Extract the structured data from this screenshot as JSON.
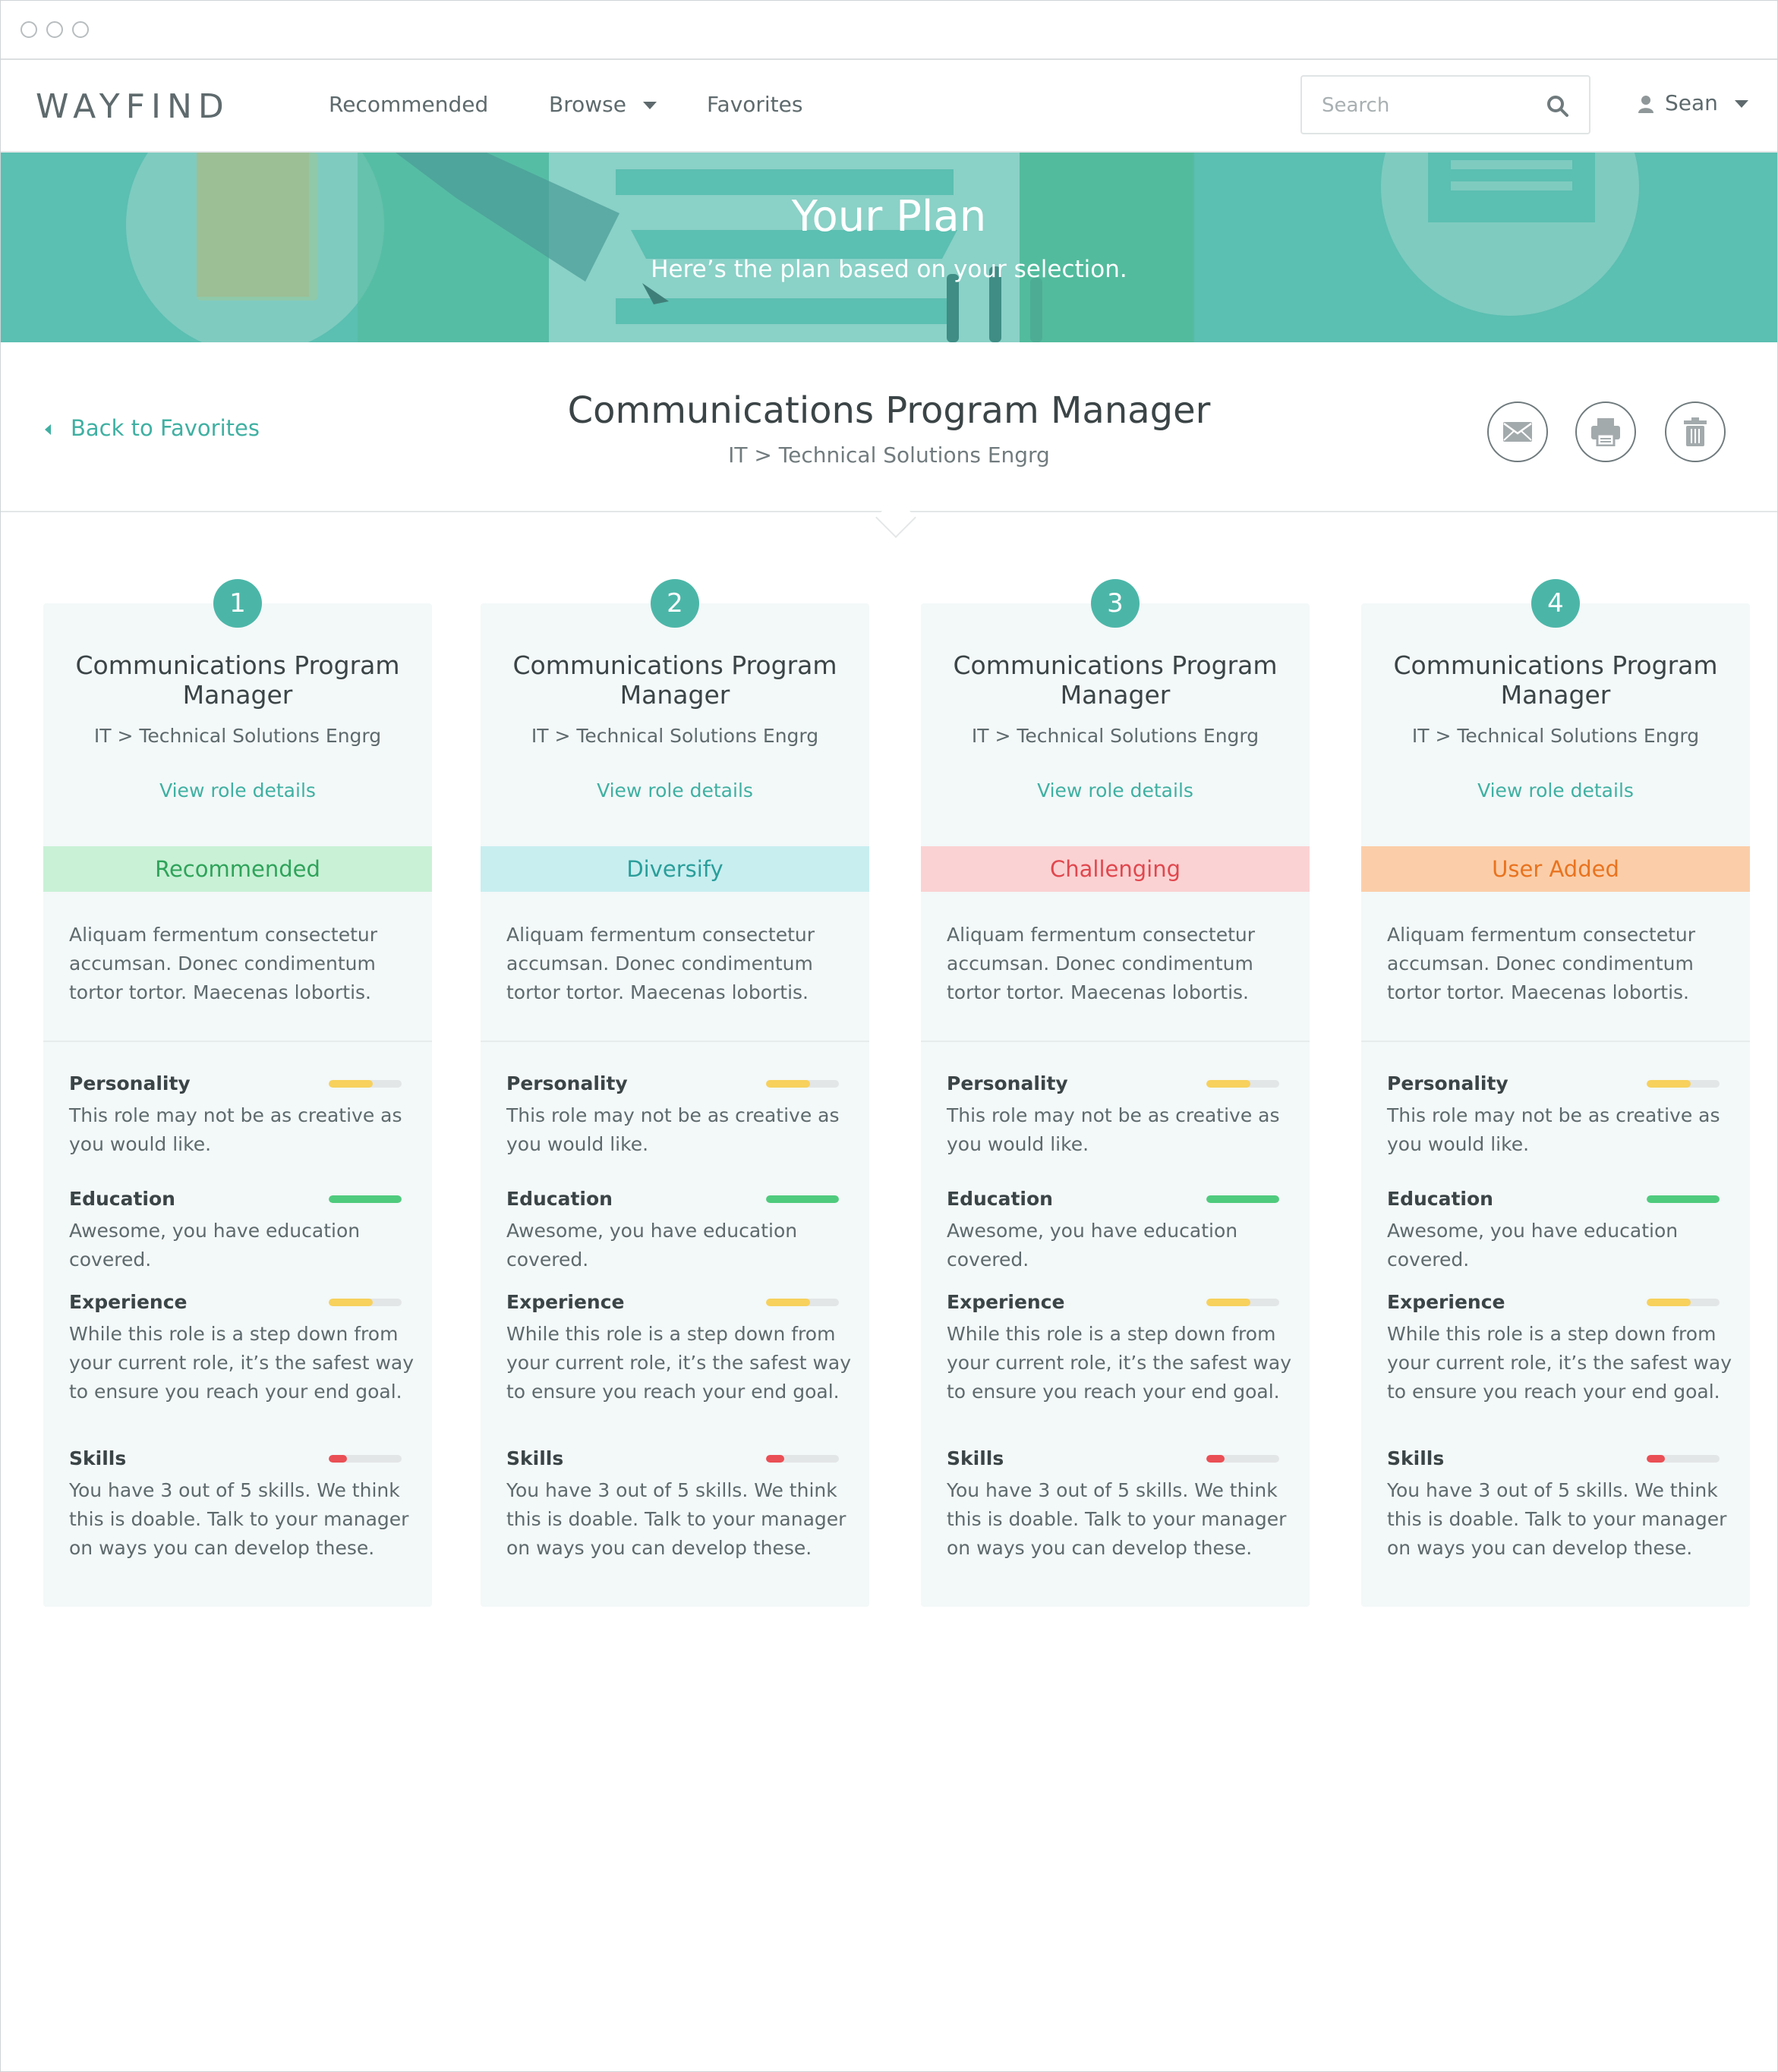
{
  "window": {
    "controls": [
      "close",
      "minimize",
      "maximize"
    ]
  },
  "nav": {
    "logo": "WAYFIND",
    "items": [
      {
        "label": "Recommended"
      },
      {
        "label": "Browse",
        "has_dropdown": true
      },
      {
        "label": "Favorites"
      }
    ],
    "search": {
      "placeholder": "Search",
      "value": ""
    },
    "user": {
      "name": "Sean"
    }
  },
  "hero": {
    "title": "Your Plan",
    "subtitle": "Here’s the plan based on your selection."
  },
  "role": {
    "back_label": "Back to Favorites",
    "title": "Communications Program Manager",
    "path": "IT > Technical Solutions Engrg",
    "actions": [
      "mail-icon",
      "print-icon",
      "trash-icon"
    ]
  },
  "colors": {
    "accent": "#4bb6a8",
    "hero_bg": "#5bbfb1",
    "bar_yellow": "#f7d15c",
    "bar_green": "#4fcb7e",
    "bar_red": "#ea4f55"
  },
  "cards": [
    {
      "number": "1",
      "title": "Communications Program Manager",
      "path": "IT > Technical Solutions Engrg",
      "link": "View role details",
      "tag": "Recommended",
      "description": "Aliquam fermentum consectetur accumsan. Donec condimentum tortor tortor. Maecenas lobortis.",
      "metrics": [
        {
          "label": "Personality",
          "text": "This role may not be as creative as you would like.",
          "level": 0.6,
          "color": "#f7d15c"
        },
        {
          "label": "Education",
          "text": "Awesome, you have education covered.",
          "level": 1.0,
          "color": "#4fcb7e"
        },
        {
          "label": "Experience",
          "text": "While this role is a step down from your current role, it’s the safest way to ensure you reach your end goal.",
          "level": 0.6,
          "color": "#f7d15c"
        },
        {
          "label": "Skills",
          "text": "You have 3 out of 5 skills. We think this is doable. Talk to your manager on ways you can develop these.",
          "level": 0.25,
          "color": "#ea4f55"
        }
      ]
    },
    {
      "number": "2",
      "title": "Communications Program Manager",
      "path": "IT > Technical Solutions Engrg",
      "link": "View role details",
      "tag": "Diversify",
      "description": "Aliquam fermentum consectetur accumsan. Donec condimentum tortor tortor. Maecenas lobortis.",
      "metrics": [
        {
          "label": "Personality",
          "text": "This role may not be as creative as you would like.",
          "level": 0.6,
          "color": "#f7d15c"
        },
        {
          "label": "Education",
          "text": "Awesome, you have education covered.",
          "level": 1.0,
          "color": "#4fcb7e"
        },
        {
          "label": "Experience",
          "text": "While this role is a step down from your current role, it’s the safest way to ensure you reach your end goal.",
          "level": 0.6,
          "color": "#f7d15c"
        },
        {
          "label": "Skills",
          "text": "You have 3 out of 5 skills. We think this is doable. Talk to your manager on ways you can develop these.",
          "level": 0.25,
          "color": "#ea4f55"
        }
      ]
    },
    {
      "number": "3",
      "title": "Communications Program Manager",
      "path": "IT > Technical Solutions Engrg",
      "link": "View role details",
      "tag": "Challenging",
      "description": "Aliquam fermentum consectetur accumsan. Donec condimentum tortor tortor. Maecenas lobortis.",
      "metrics": [
        {
          "label": "Personality",
          "text": "This role may not be as creative as you would like.",
          "level": 0.6,
          "color": "#f7d15c"
        },
        {
          "label": "Education",
          "text": "Awesome, you have education covered.",
          "level": 1.0,
          "color": "#4fcb7e"
        },
        {
          "label": "Experience",
          "text": "While this role is a step down from your current role, it’s the safest way to ensure you reach your end goal.",
          "level": 0.6,
          "color": "#f7d15c"
        },
        {
          "label": "Skills",
          "text": "You have 3 out of 5 skills. We think this is doable. Talk to your manager on ways you can develop these.",
          "level": 0.25,
          "color": "#ea4f55"
        }
      ]
    },
    {
      "number": "4",
      "title": "Communications Program Manager",
      "path": "IT > Technical Solutions Engrg",
      "link": "View role details",
      "tag": "User Added",
      "description": "Aliquam fermentum consectetur accumsan. Donec condimentum tortor tortor. Maecenas lobortis.",
      "metrics": [
        {
          "label": "Personality",
          "text": "This role may not be as creative as you would like.",
          "level": 0.6,
          "color": "#f7d15c"
        },
        {
          "label": "Education",
          "text": "Awesome, you have education covered.",
          "level": 1.0,
          "color": "#4fcb7e"
        },
        {
          "label": "Experience",
          "text": "While this role is a step down from your current role, it’s the safest way to ensure you reach your end goal.",
          "level": 0.6,
          "color": "#f7d15c"
        },
        {
          "label": "Skills",
          "text": "You have 3 out of 5 skills. We think this is doable. Talk to your manager on ways you can develop these.",
          "level": 0.25,
          "color": "#ea4f55"
        }
      ]
    }
  ]
}
